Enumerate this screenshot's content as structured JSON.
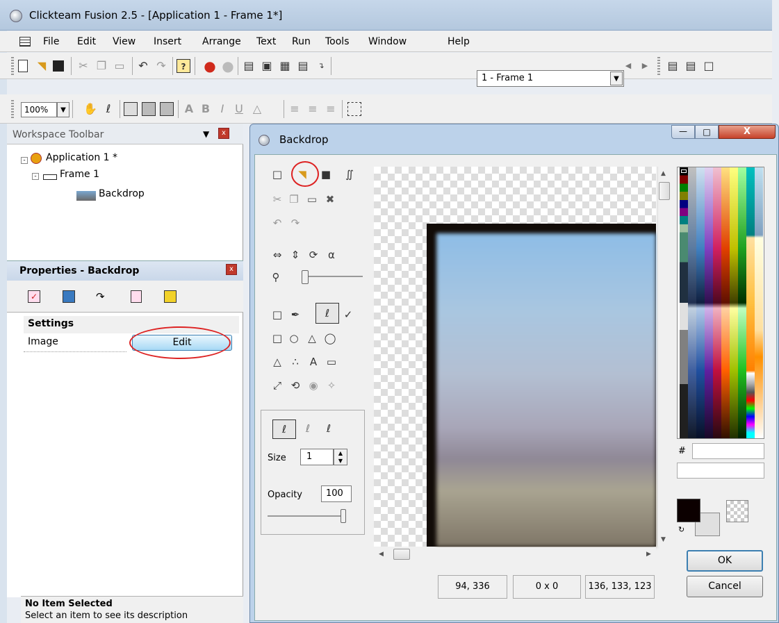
{
  "window": {
    "title": "Clickteam Fusion 2.5 - [Application 1 - Frame 1*]"
  },
  "menu": [
    "File",
    "Edit",
    "View",
    "Insert",
    "Arrange",
    "Text",
    "Run",
    "Tools",
    "Window",
    "Help"
  ],
  "toolbar": {
    "frame_select": "1 - Frame 1",
    "zoom": "100%"
  },
  "workspace": {
    "title": "Workspace Toolbar",
    "tree": [
      "Application 1 *",
      "Frame 1",
      "Backdrop"
    ]
  },
  "properties": {
    "title": "Properties - Backdrop",
    "settings_header": "Settings",
    "image_label": "Image",
    "edit_label": "Edit"
  },
  "status": {
    "title": "No Item Selected",
    "description": "Select an item to see its description"
  },
  "dialog": {
    "title": "Backdrop",
    "close_glyph": "X",
    "size_label": "Size",
    "size_value": "1",
    "opacity_label": "Opacity",
    "opacity_value": "100",
    "status_position": "94, 336",
    "status_size": "0 x 0",
    "status_color": "136, 133, 123",
    "hash_label": "#",
    "ok_label": "OK",
    "cancel_label": "Cancel"
  },
  "palette_colors": [
    "#000000",
    "#800000",
    "#008000",
    "#808000",
    "#000080",
    "#800080",
    "#008080",
    "#c0c0c0",
    "#404060",
    "#203050",
    "#c0c8d0",
    "#e0e0e0"
  ],
  "icons": [
    "new-icon",
    "open-icon",
    "save-icon",
    "cut-icon",
    "copy-icon",
    "paste-icon",
    "undo-icon",
    "redo-icon",
    "help-icon",
    "run-icon",
    "stop-icon",
    "prev-icon",
    "next-icon"
  ]
}
